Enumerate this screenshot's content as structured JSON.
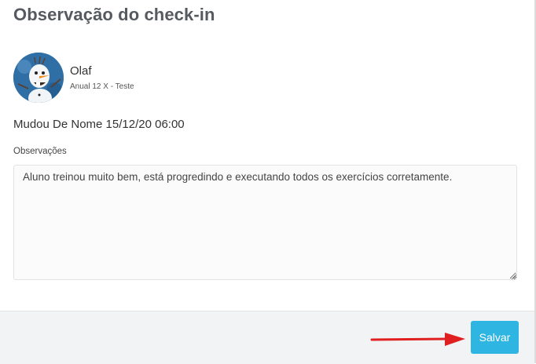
{
  "modal": {
    "title": "Observação do check-in"
  },
  "student": {
    "name": "Olaf",
    "plan": "Anual 12 X - Teste",
    "avatar_icon": "olaf-avatar"
  },
  "checkin": {
    "info": "Mudou De Nome 15/12/20 06:00"
  },
  "observations": {
    "label": "Observações",
    "value": "Aluno treinou muito bem, está progredindo e executando todos os exercícios corretamente."
  },
  "footer": {
    "save_label": "Salvar",
    "save_color": "#2fb5e2"
  },
  "annotation": {
    "arrow_icon": "red-arrow-icon",
    "arrow_color": "#e02020"
  }
}
